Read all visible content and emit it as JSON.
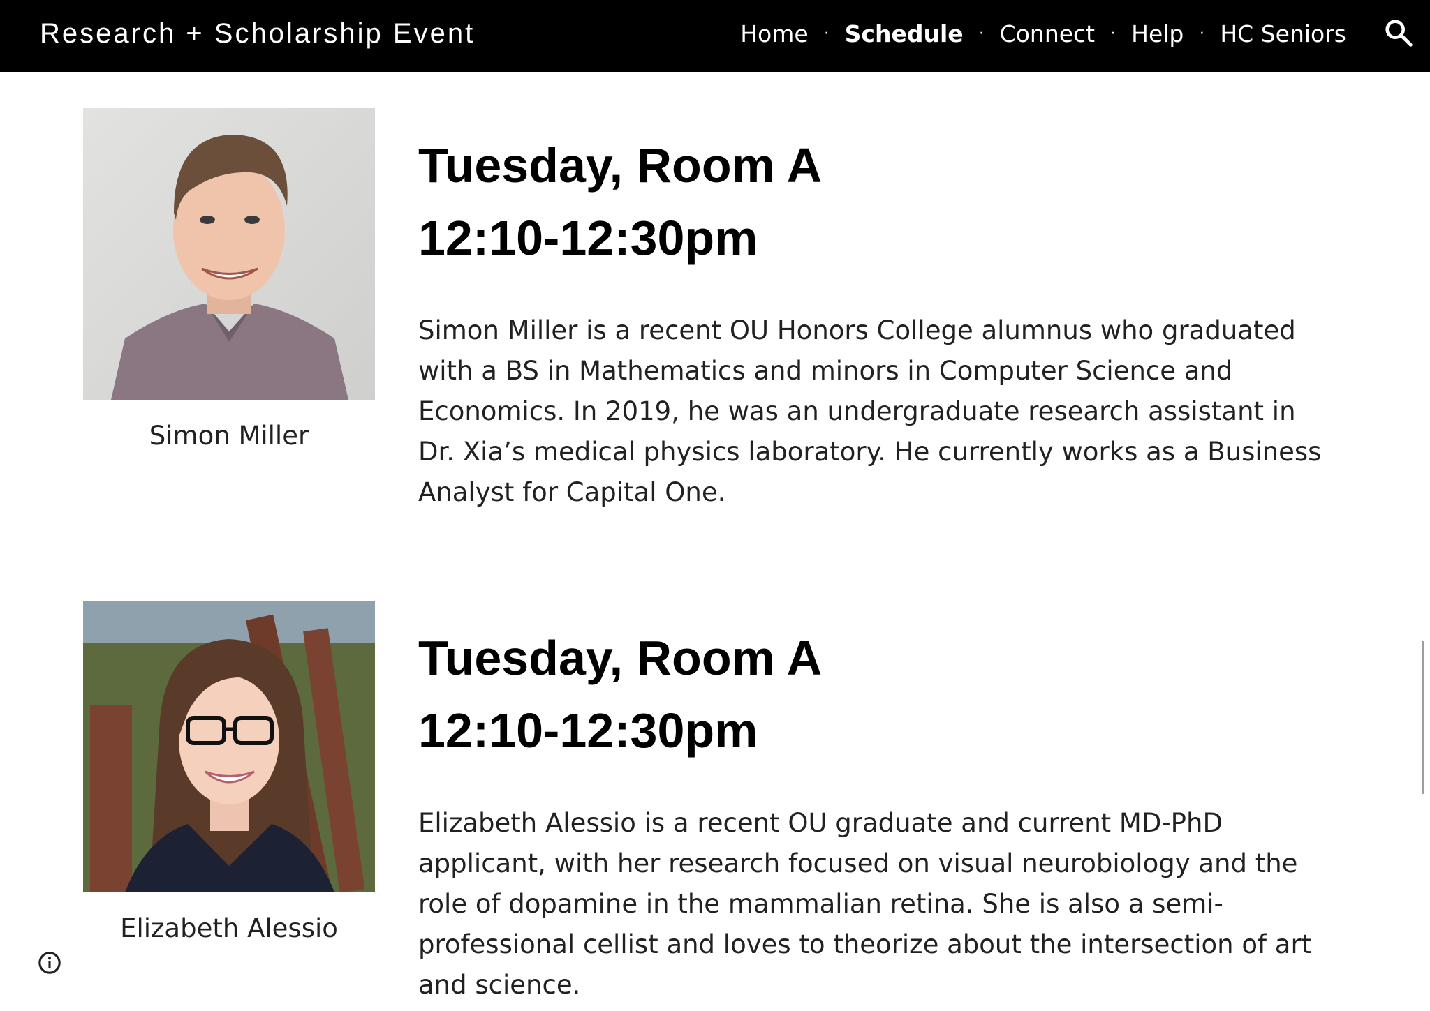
{
  "header": {
    "site_title": "Research + Scholarship Event",
    "nav": [
      {
        "label": "Home",
        "active": false
      },
      {
        "label": "Schedule",
        "active": true
      },
      {
        "label": "Connect",
        "active": false
      },
      {
        "label": "Help",
        "active": false
      },
      {
        "label": "HC Seniors",
        "active": false
      }
    ],
    "separator": "·",
    "search_icon": "search-icon"
  },
  "presenters": [
    {
      "name": "Simon Miller",
      "session_day_room": "Tuesday, Room A",
      "session_time": "12:10-12:30pm",
      "bio": "Simon Miller is a recent OU Honors College alumnus who graduated with a BS in Mathematics and minors in Computer Science and Economics. In 2019, he was an undergraduate research assistant in Dr. Xia’s medical physics laboratory. He currently works as a Business Analyst for Capital One."
    },
    {
      "name": "Elizabeth Alessio",
      "session_day_room": "Tuesday, Room A",
      "session_time": "12:10-12:30pm",
      "bio": "Elizabeth Alessio is a recent OU graduate and current MD-PhD applicant, with her research focused on visual neurobiology and the role of dopamine in the mammalian retina. She is also a semi-professional cellist and loves to theorize about the intersection of art and science."
    }
  ],
  "footer": {
    "info_icon": "info-icon"
  },
  "colors": {
    "header_bg": "#000000",
    "header_text": "#ffffff",
    "body_text": "#212121",
    "heading_text": "#000000"
  }
}
